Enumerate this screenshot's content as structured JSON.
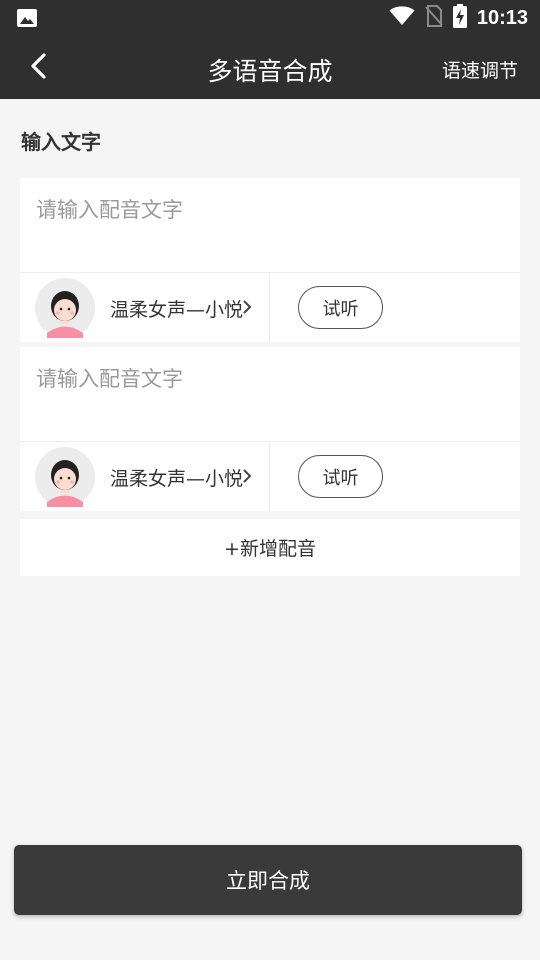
{
  "status_bar": {
    "time": "10:13",
    "icons": [
      "gallery-icon",
      "wifi-icon",
      "no-sim-icon",
      "battery-charging-icon"
    ]
  },
  "app_bar": {
    "back_icon": "chevron-left-icon",
    "title": "多语音合成",
    "speed_label": "语速调节"
  },
  "section": {
    "label": "输入文字"
  },
  "dubbing_items": [
    {
      "placeholder": "请输入配音文字",
      "text": "",
      "voice_name": "温柔女声—小悦",
      "try_label": "试听"
    },
    {
      "placeholder": "请输入配音文字",
      "text": "",
      "voice_name": "温柔女声—小悦",
      "try_label": "试听"
    }
  ],
  "add_label": "+新增配音",
  "synthesize_label": "立即合成",
  "colors": {
    "header_bg": "#2f2f2f",
    "page_bg": "#f5f5f5",
    "button_bg": "#3a3a3a",
    "avatar_accent": "#f78fa6"
  }
}
